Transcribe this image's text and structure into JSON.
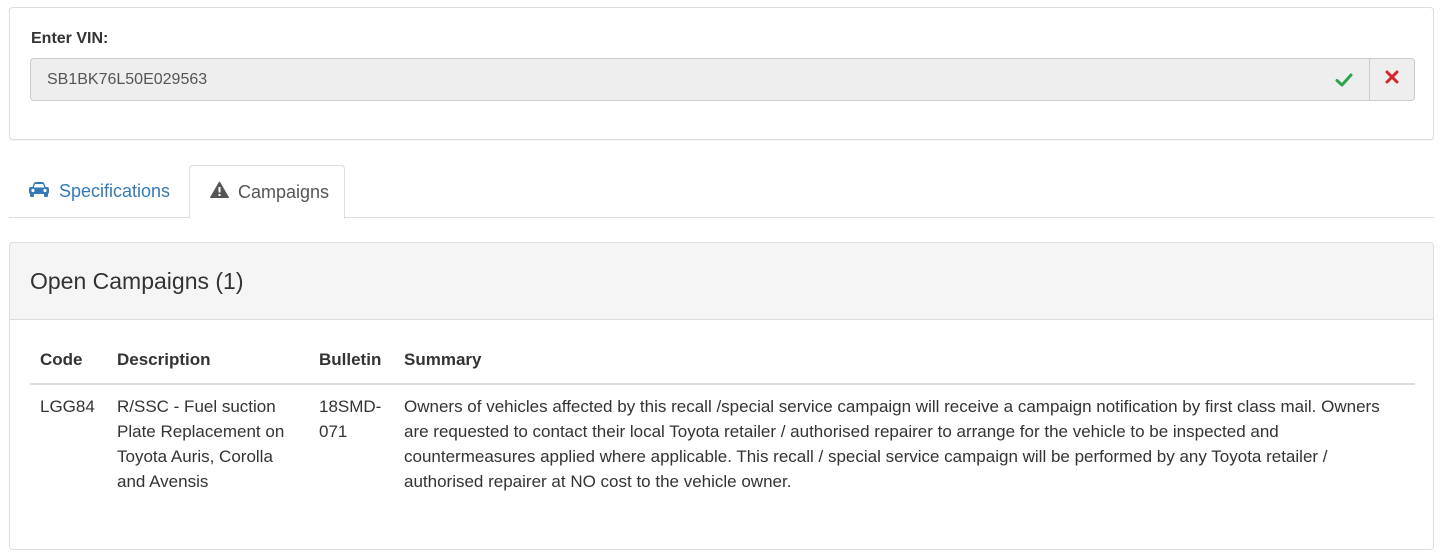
{
  "vin": {
    "label": "Enter VIN:",
    "value": "SB1BK76L50E029563",
    "valid_icon": "check-icon",
    "clear_icon": "close-icon",
    "valid_color": "#2ea44f",
    "clear_color": "#d9252b"
  },
  "tabs": [
    {
      "label": "Specifications",
      "icon": "car-icon",
      "active": false
    },
    {
      "label": "Campaigns",
      "icon": "warning-icon",
      "active": true
    }
  ],
  "campaigns": {
    "heading": "Open Campaigns (1)",
    "columns": [
      "Code",
      "Description",
      "Bulletin",
      "Summary"
    ],
    "rows": [
      {
        "code": "LGG84",
        "description": "R/SSC - Fuel suction Plate Replacement on Toyota Auris, Corolla and Avensis",
        "bulletin": "18SMD-071",
        "summary": "Owners of vehicles affected by this recall /special service campaign will receive a campaign notification by first class mail. Owners are requested to contact their local Toyota retailer / authorised repairer to arrange for the vehicle to be inspected and countermeasures applied where applicable. This recall / special service campaign will be performed by any Toyota retailer / authorised repairer at NO cost to the vehicle owner."
      }
    ]
  },
  "colors": {
    "link": "#337ab7",
    "border": "#dddddd",
    "panel_heading_bg": "#f5f5f5"
  }
}
